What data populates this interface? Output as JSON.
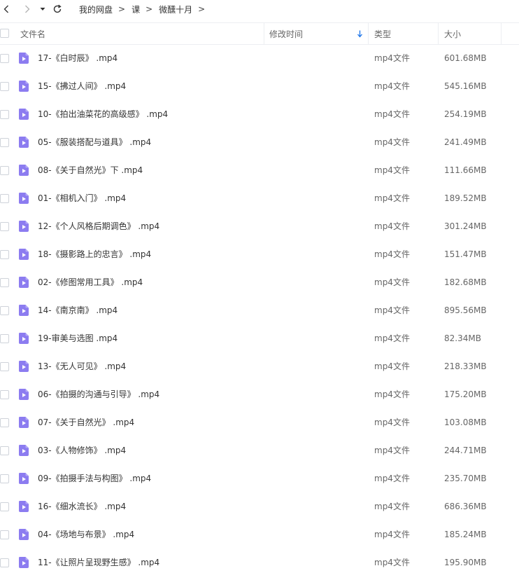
{
  "nav": {
    "breadcrumbs": [
      "我的网盘",
      "课",
      "微醺十月"
    ],
    "separator": ">"
  },
  "columns": {
    "name": "文件名",
    "modified": "修改时间",
    "type": "类型",
    "size": "大小"
  },
  "sort": {
    "column": "modified",
    "direction": "desc",
    "indicator_color": "#1a73e8"
  },
  "file_icon_color": "#8c7cf0",
  "files": [
    {
      "name": "17-《白时辰》 .mp4",
      "type": "mp4文件",
      "size": "601.68MB"
    },
    {
      "name": "15-《拂过人间》 .mp4",
      "type": "mp4文件",
      "size": "545.16MB"
    },
    {
      "name": "10-《拍出油菜花的高级感》 .mp4",
      "type": "mp4文件",
      "size": "254.19MB"
    },
    {
      "name": "05-《服装搭配与道具》 .mp4",
      "type": "mp4文件",
      "size": "241.49MB"
    },
    {
      "name": "08-《关于自然光》下 .mp4",
      "type": "mp4文件",
      "size": "111.66MB"
    },
    {
      "name": "01-《相机入门》 .mp4",
      "type": "mp4文件",
      "size": "189.52MB"
    },
    {
      "name": "12-《个人风格后期调色》 .mp4",
      "type": "mp4文件",
      "size": "301.24MB"
    },
    {
      "name": "18-《摄影路上的忠言》 .mp4",
      "type": "mp4文件",
      "size": "151.47MB"
    },
    {
      "name": "02-《修图常用工具》 .mp4",
      "type": "mp4文件",
      "size": "182.68MB"
    },
    {
      "name": "14-《南京南》 .mp4",
      "type": "mp4文件",
      "size": "895.56MB"
    },
    {
      "name": "19-审美与选图 .mp4",
      "type": "mp4文件",
      "size": "82.34MB"
    },
    {
      "name": "13-《无人可见》 .mp4",
      "type": "mp4文件",
      "size": "218.33MB"
    },
    {
      "name": "06-《拍摄的沟通与引导》 .mp4",
      "type": "mp4文件",
      "size": "175.20MB"
    },
    {
      "name": "07-《关于自然光》 .mp4",
      "type": "mp4文件",
      "size": "103.08MB"
    },
    {
      "name": "03-《人物修饰》 .mp4",
      "type": "mp4文件",
      "size": "244.71MB"
    },
    {
      "name": "09-《拍摄手法与构图》 .mp4",
      "type": "mp4文件",
      "size": "235.70MB"
    },
    {
      "name": "16-《细水流长》 .mp4",
      "type": "mp4文件",
      "size": "686.36MB"
    },
    {
      "name": "04-《场地与布景》 .mp4",
      "type": "mp4文件",
      "size": "185.24MB"
    },
    {
      "name": "11-《让照片呈现野生感》 .mp4",
      "type": "mp4文件",
      "size": "195.90MB"
    }
  ]
}
